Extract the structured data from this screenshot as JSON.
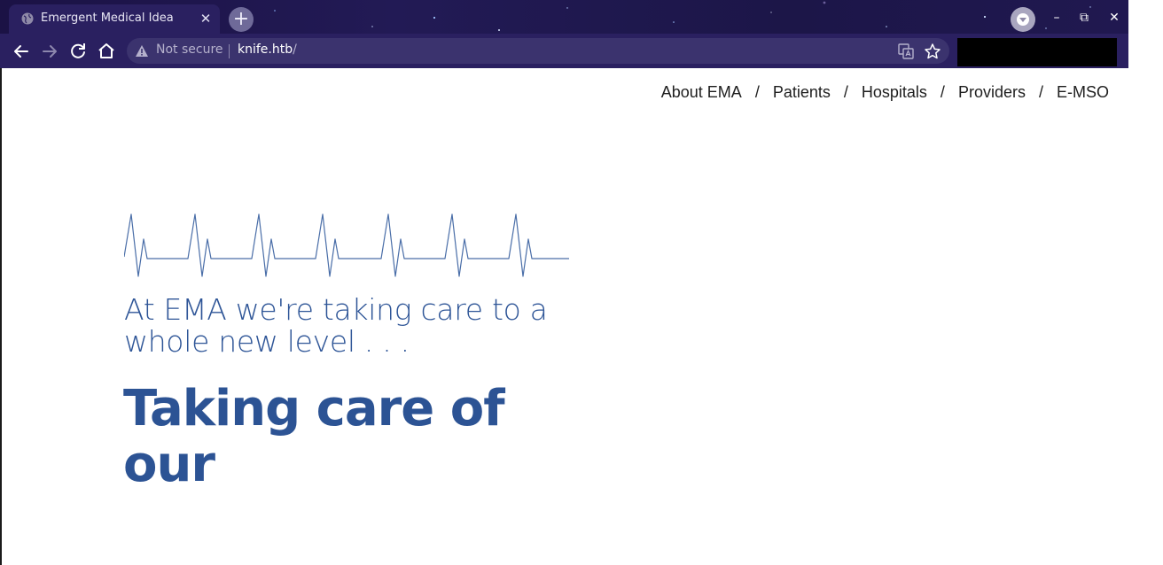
{
  "browser": {
    "tab_title": "Emergent Medical Idea",
    "tab_close": "✕",
    "new_tab_symbol": "+",
    "security_label": "Not secure",
    "url_host": "knife.htb",
    "url_path": "/",
    "icons": {
      "back": "arrow-left-icon",
      "forward": "arrow-right-icon",
      "reload": "reload-icon",
      "home": "home-icon",
      "warning": "warning-icon",
      "translate": "translate-icon",
      "bookmark": "star-icon",
      "profile": "profile-icon"
    },
    "window_controls": {
      "minimize": "–",
      "restore": "⧉",
      "close": "✕"
    },
    "colors": {
      "frame": "#1b1245",
      "toolbar": "#2a2060",
      "omnibox": "#3b336e"
    }
  },
  "site": {
    "nav": [
      {
        "label": "About EMA"
      },
      {
        "label": "Patients"
      },
      {
        "label": "Hospitals"
      },
      {
        "label": "Providers"
      },
      {
        "label": "E-MSO"
      }
    ],
    "separator": "/",
    "hero": {
      "tagline": "At EMA we're taking care to a whole new level . . .",
      "headline": "Taking care of our"
    },
    "colors": {
      "accent": "#2e5597",
      "nav_text": "#1e1e1e"
    }
  }
}
